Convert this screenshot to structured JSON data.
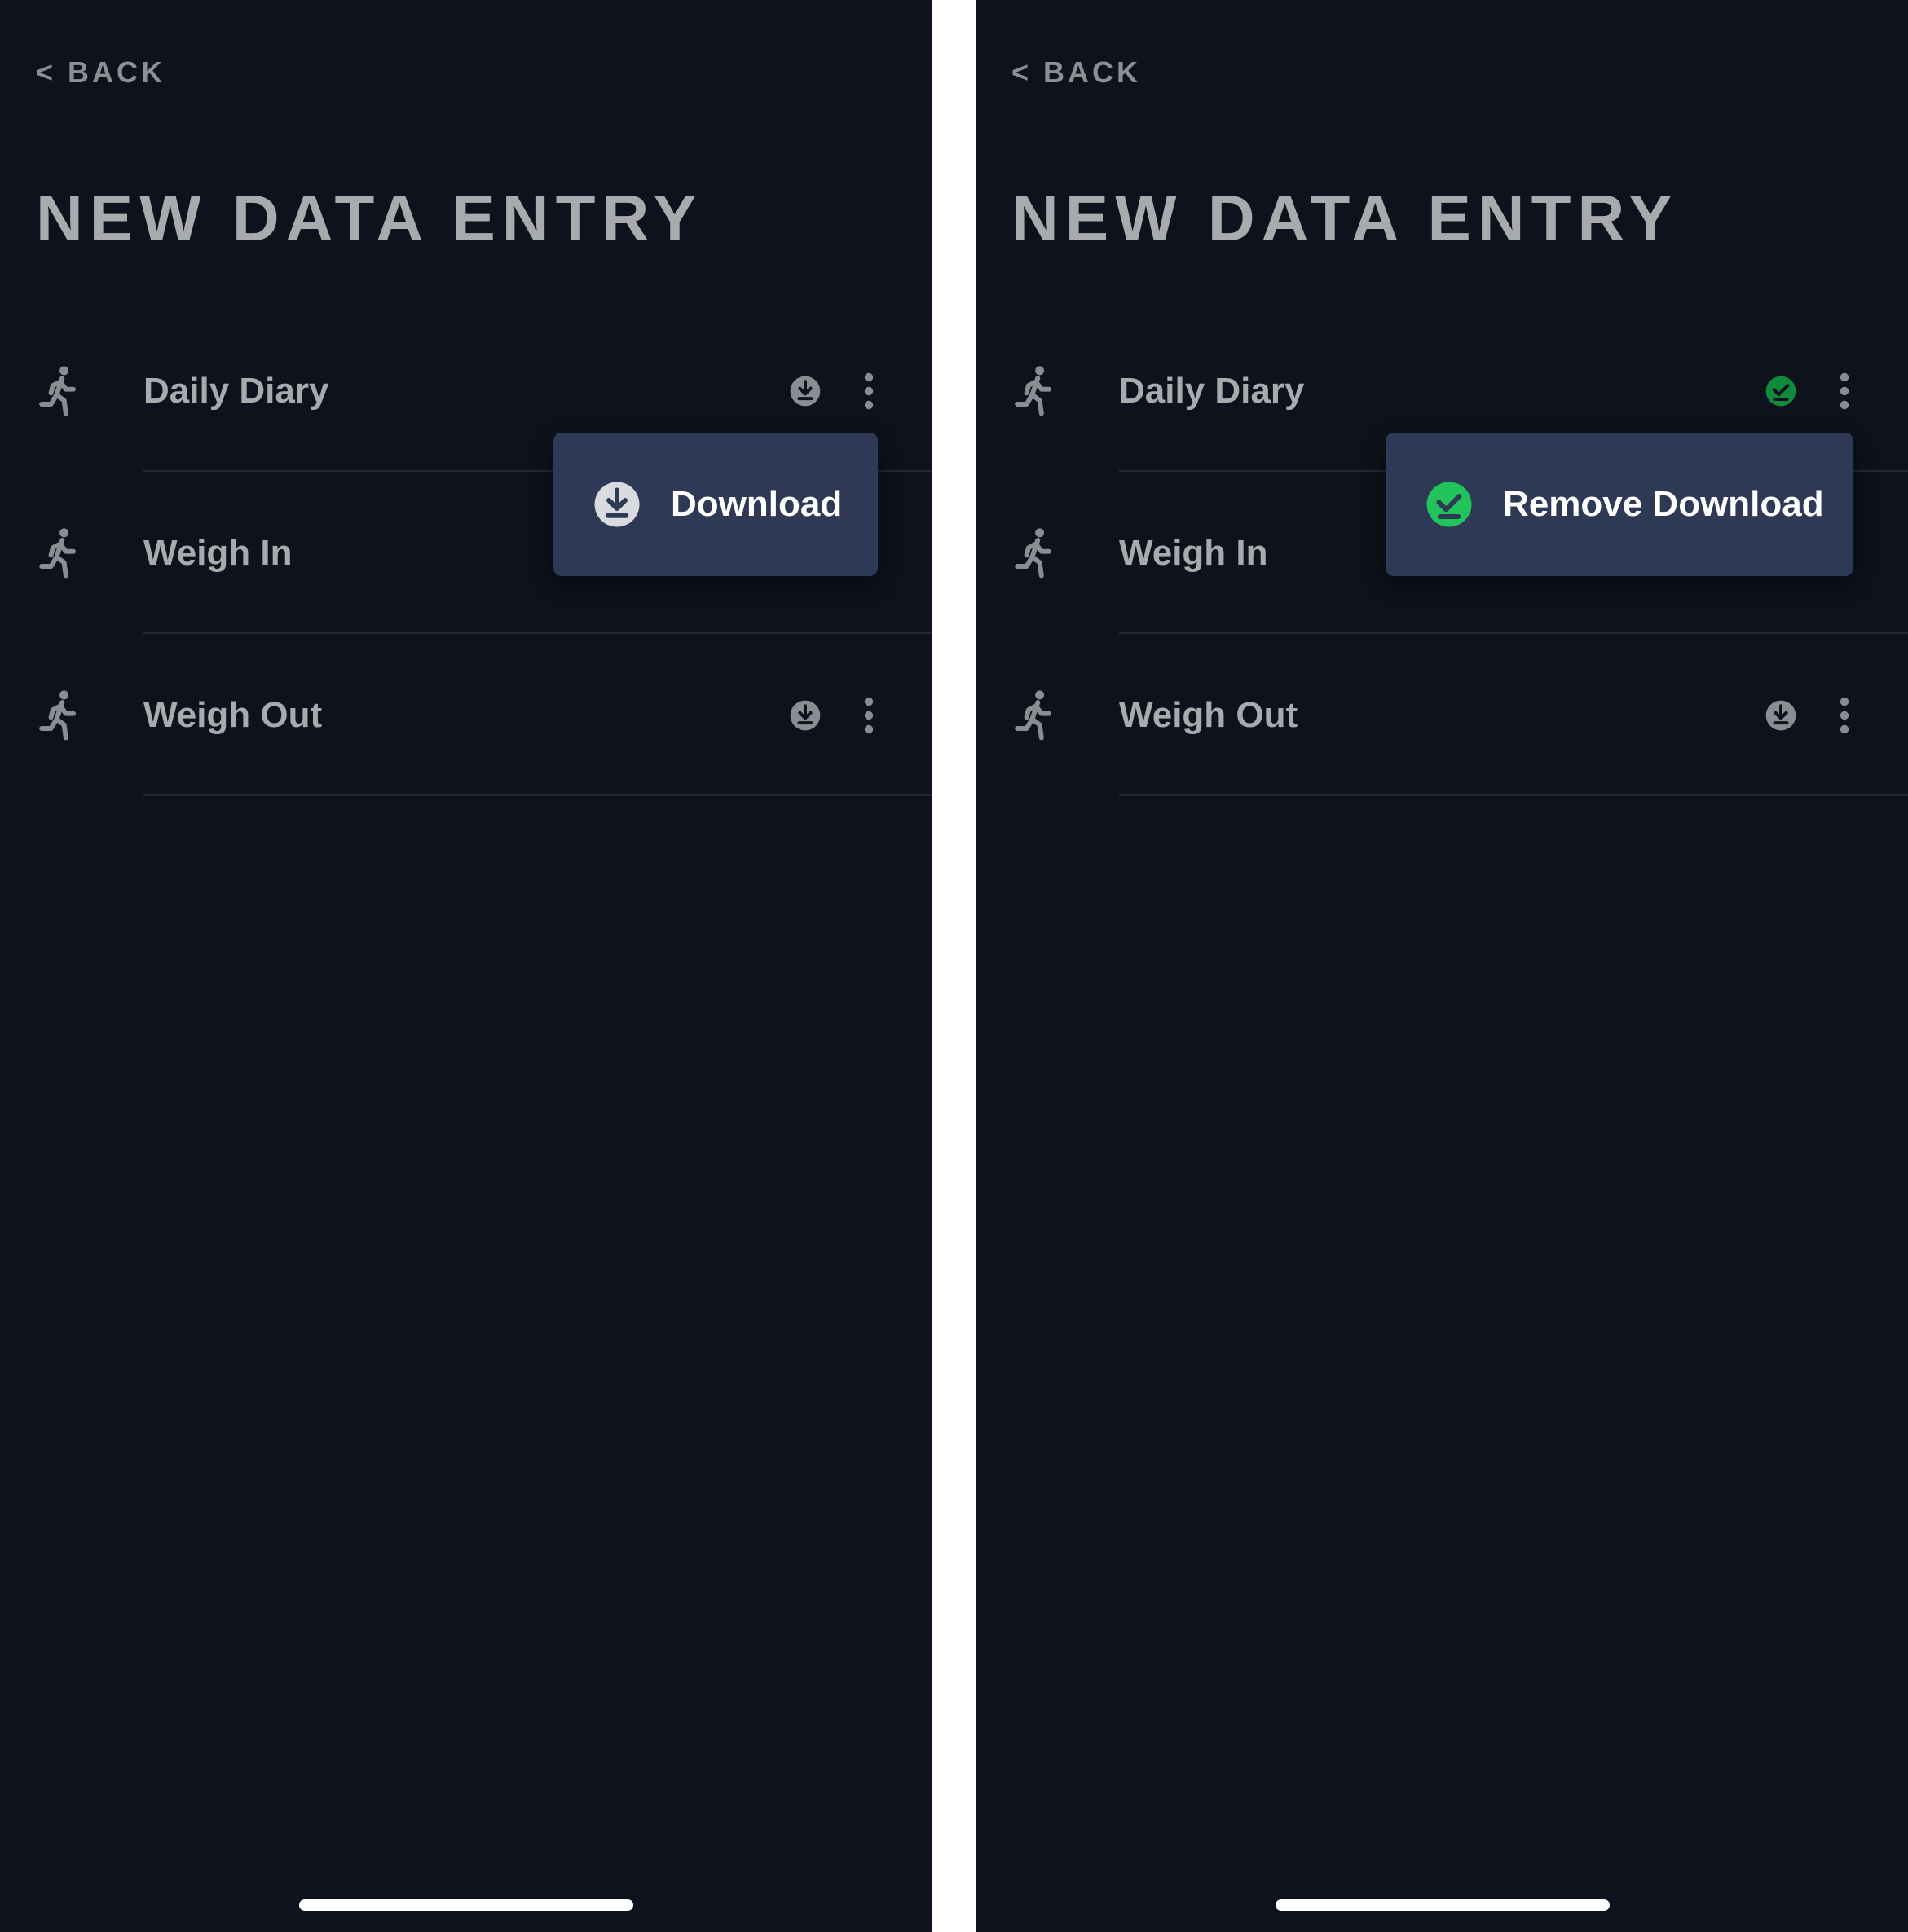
{
  "colors": {
    "background": "#0d121c",
    "menu_background": "#2e3a55",
    "text_muted": "#a8aaad",
    "icon_grey": "#8a8d91",
    "success_green": "#21c45a",
    "success_dark": "#128a3c"
  },
  "screens": [
    {
      "back_label": "< BACK",
      "title": "NEW DATA ENTRY",
      "items": [
        {
          "label": "Daily Diary",
          "icon": "runner-icon",
          "status": "download"
        },
        {
          "label": "Weigh In",
          "icon": "runner-icon",
          "status": "download"
        },
        {
          "label": "Weigh Out",
          "icon": "runner-icon",
          "status": "download"
        }
      ],
      "menu": {
        "label": "Download",
        "icon": "download-icon"
      }
    },
    {
      "back_label": "< BACK",
      "title": "NEW DATA ENTRY",
      "items": [
        {
          "label": "Daily Diary",
          "icon": "runner-icon",
          "status": "downloaded"
        },
        {
          "label": "Weigh In",
          "icon": "runner-icon",
          "status": "download"
        },
        {
          "label": "Weigh Out",
          "icon": "runner-icon",
          "status": "download"
        }
      ],
      "menu": {
        "label": "Remove Download",
        "icon": "check-circle-icon"
      }
    }
  ]
}
